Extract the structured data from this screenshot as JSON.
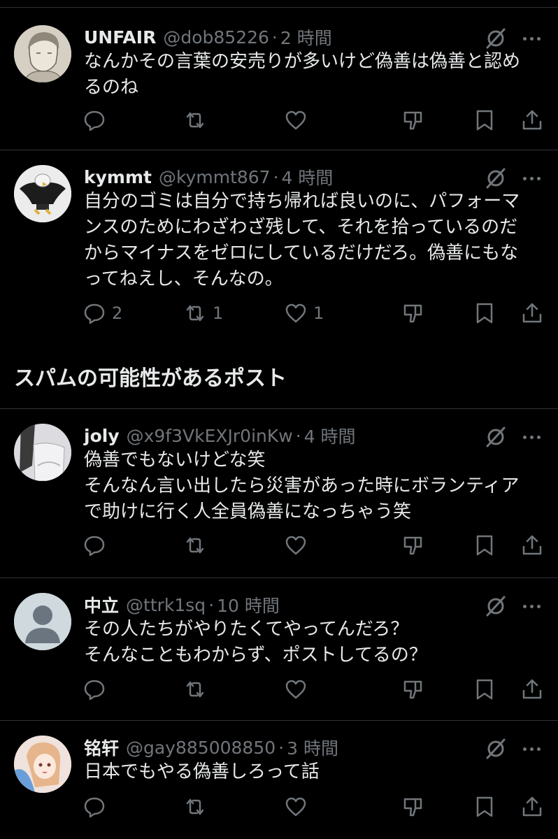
{
  "section_title": "スパムの可能性があるポスト",
  "posts": [
    {
      "name": "UNFAIR",
      "handle": "@dob85226",
      "time": "2 時間",
      "lines": [
        "なんかその言葉の安売りが多いけど偽善は偽善と認め",
        "るのね"
      ],
      "replies": "",
      "reposts": "",
      "likes": ""
    },
    {
      "name": "kymmt",
      "handle": "@kymmt867",
      "time": "4 時間",
      "lines": [
        "自分のゴミは自分で持ち帰れば良いのに、パフォーマ",
        "ンスのためにわざわざ残して、それを拾っているのだ",
        "からマイナスをゼロにしているだけだろ。偽善にもな",
        "ってねえし、そんなの。"
      ],
      "replies": "2",
      "reposts": "1",
      "likes": "1"
    },
    {
      "name": "joly",
      "handle": "@x9f3VkEXJr0inKw",
      "time": "4 時間",
      "lines": [
        "偽善でもないけどな笑",
        "そんなん言い出したら災害があった時にボランティア",
        "で助けに行く人全員偽善になっちゃう笑"
      ],
      "replies": "",
      "reposts": "",
      "likes": ""
    },
    {
      "name": "中立",
      "handle": "@ttrk1sq",
      "time": "10 時間",
      "lines": [
        "その人たちがやりたくてやってんだろ？",
        "そんなこともわからず、ポストしてるの？"
      ],
      "replies": "",
      "reposts": "",
      "likes": ""
    },
    {
      "name": "铭轩",
      "handle": "@gay885008850",
      "time": "3 時間",
      "lines": [
        "日本でもやる偽善しろって話"
      ],
      "replies": "",
      "reposts": "",
      "likes": ""
    }
  ],
  "colors": {
    "background": "#000000",
    "text": "#e7e9ea",
    "muted": "#71767b",
    "divider": "#2f3336"
  },
  "icons": [
    "reply-icon",
    "repost-icon",
    "like-icon",
    "dislike-icon",
    "bookmark-icon",
    "share-icon",
    "grok-icon",
    "more-icon"
  ]
}
